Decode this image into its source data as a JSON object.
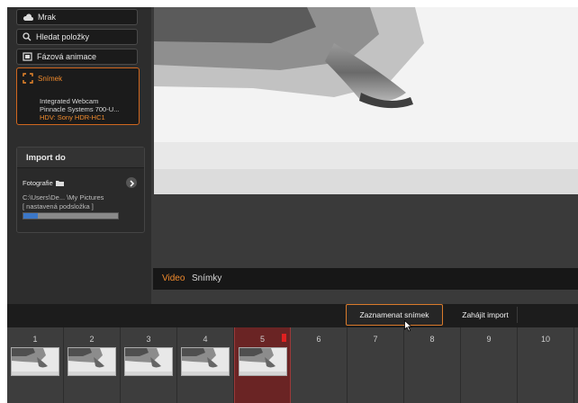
{
  "sidebar": {
    "sources": [
      {
        "label": "Mrak",
        "icon": "cloud-icon"
      },
      {
        "label": "Hledat položky",
        "icon": "search-icon"
      },
      {
        "label": "Fázová animace",
        "icon": "stop-motion-icon"
      }
    ],
    "snimek": {
      "label": "Snímek",
      "icon": "snapshot-icon",
      "devices": [
        {
          "label": "Integrated Webcam",
          "active": false
        },
        {
          "label": "Pinnacle Systems 700-U...",
          "active": false
        },
        {
          "label": "HDV: Sony HDR-HC1",
          "active": true
        }
      ]
    },
    "import": {
      "title": "Import do",
      "folder_label": "Fotografie",
      "path": "C:\\Users\\De...  \\My Pictures",
      "subfolder": "[ nastavená podsložka ]",
      "progress": 0.15
    }
  },
  "preview_tabs": {
    "video": "Video",
    "snimky": "Snímky"
  },
  "toolbar": {
    "capture": "Zaznamenat snímek",
    "start_import": "Zahájit import"
  },
  "filmstrip": {
    "slots": [
      {
        "num": "1",
        "has_thumb": true
      },
      {
        "num": "2",
        "has_thumb": true
      },
      {
        "num": "3",
        "has_thumb": true
      },
      {
        "num": "4",
        "has_thumb": true
      },
      {
        "num": "5",
        "has_thumb": true,
        "active": true
      },
      {
        "num": "6",
        "has_thumb": false
      },
      {
        "num": "7",
        "has_thumb": false
      },
      {
        "num": "8",
        "has_thumb": false
      },
      {
        "num": "9",
        "has_thumb": false
      },
      {
        "num": "10",
        "has_thumb": false
      }
    ]
  },
  "colors": {
    "accent": "#f08a2c",
    "active_slot": "#6a2424"
  }
}
